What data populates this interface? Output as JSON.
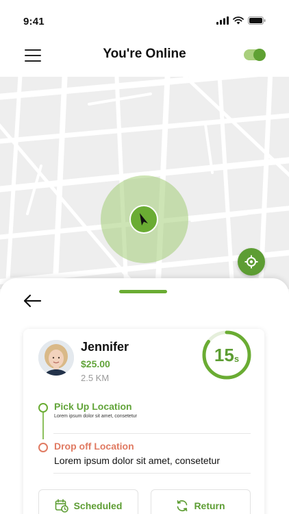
{
  "status_bar": {
    "time": "9:41"
  },
  "header": {
    "title": "You're Online",
    "online_toggle_on": true
  },
  "rider": {
    "name": "Jennifer",
    "fare": "$25.00",
    "distance": "2.5 KM"
  },
  "timer": {
    "value": "15",
    "unit": "s",
    "remaining_fraction": 0.85
  },
  "route": {
    "pickup_title": "Pick Up Location",
    "pickup_address": "Lorem ipsum dolor sit amet, consetetur",
    "drop_title": "Drop off Location",
    "drop_address": "Lorem ipsum dolor sit amet, consetetur"
  },
  "actions": {
    "scheduled_label": "Scheduled",
    "return_label": "Return"
  },
  "colors": {
    "accent_green": "#5d9d33",
    "light_green": "#a4ce78",
    "drop_red": "#e07a62",
    "map_bg": "#eeeeee"
  },
  "icons": {
    "menu": "hamburger-icon",
    "navigation": "navigation-arrow-icon",
    "recenter": "crosshair-icon",
    "back": "arrow-left-icon",
    "scheduled": "calendar-clock-icon",
    "return": "refresh-icon"
  }
}
